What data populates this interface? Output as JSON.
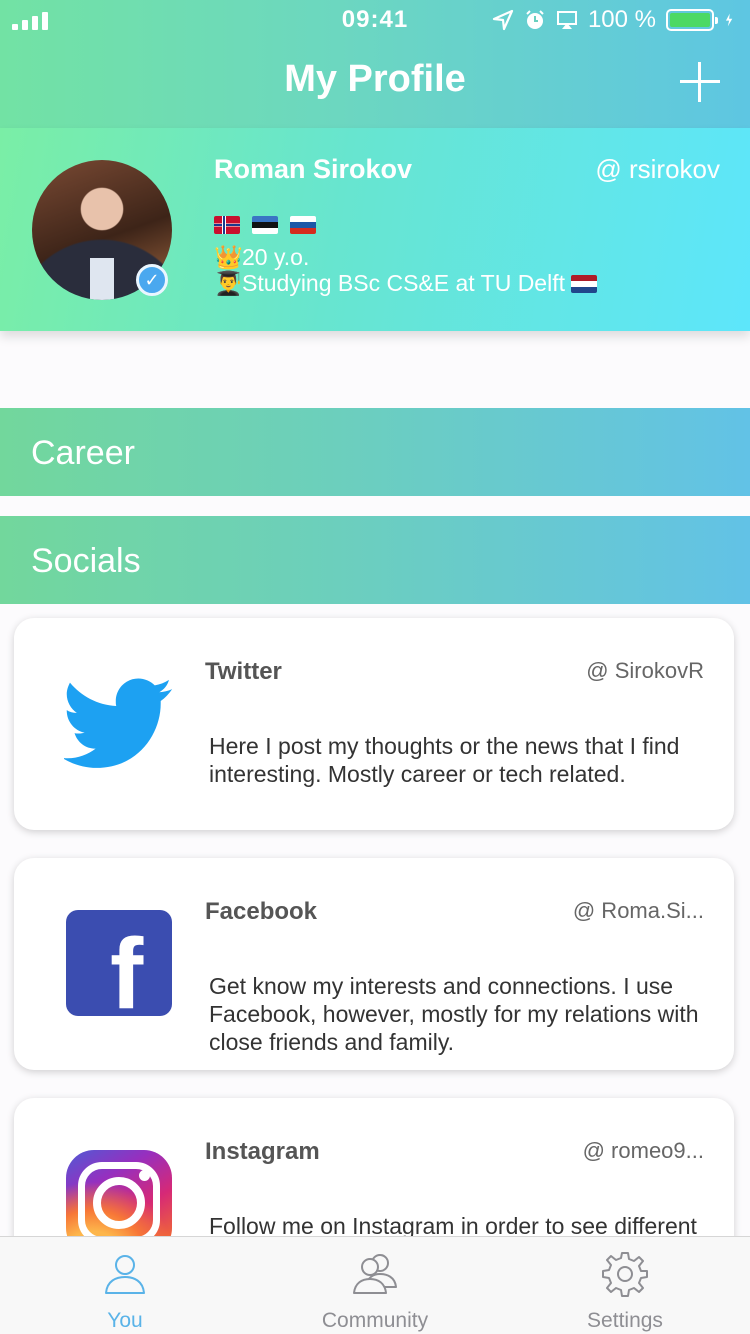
{
  "status_bar": {
    "time": "09:41",
    "battery_percent": "100 %",
    "icons": [
      "signal-icon",
      "location-icon",
      "alarm-icon",
      "airplay-icon",
      "battery-icon",
      "charging-icon"
    ]
  },
  "nav": {
    "title": "My Profile",
    "add_icon": "plus-icon"
  },
  "profile": {
    "name": "Roman Sirokov",
    "handle": "@ rsirokov",
    "flags": [
      "norway-flag",
      "estonia-flag",
      "russia-flag"
    ],
    "age": "20 y.o.",
    "study": "Studying BSc CS&E at TU Delft",
    "age_emoji": "👑",
    "study_emoji": "👨‍🎓",
    "verified_icon": "verified-checkmark-icon"
  },
  "sections": {
    "career": "Career",
    "socials": "Socials"
  },
  "socials": [
    {
      "title": "Twitter",
      "handle": "@ SirokovR",
      "description": "Here I post my thoughts or the news that I find interesting. Mostly career or tech related.",
      "icon": "twitter-bird-icon"
    },
    {
      "title": "Facebook",
      "handle": "@ Roma.Si...",
      "description": "Get know my interests and connections. I use Facebook, however, mostly for my relations with close friends and family.",
      "icon": "facebook-icon"
    },
    {
      "title": "Instagram",
      "handle": "@ romeo9...",
      "description": "Follow me on Instagram in order to see different moments of my life that I find",
      "icon": "instagram-icon"
    }
  ],
  "tabs": [
    {
      "label": "You",
      "icon": "person-icon",
      "active": true
    },
    {
      "label": "Community",
      "icon": "people-icon",
      "active": false
    },
    {
      "label": "Settings",
      "icon": "gear-icon",
      "active": false
    }
  ],
  "colors": {
    "accent_blue": "#5ab3e8",
    "twitter_blue": "#1da1f2",
    "facebook_blue": "#3b4db0",
    "header_green": "#72e2a4",
    "header_blue": "#5ec6e2"
  }
}
